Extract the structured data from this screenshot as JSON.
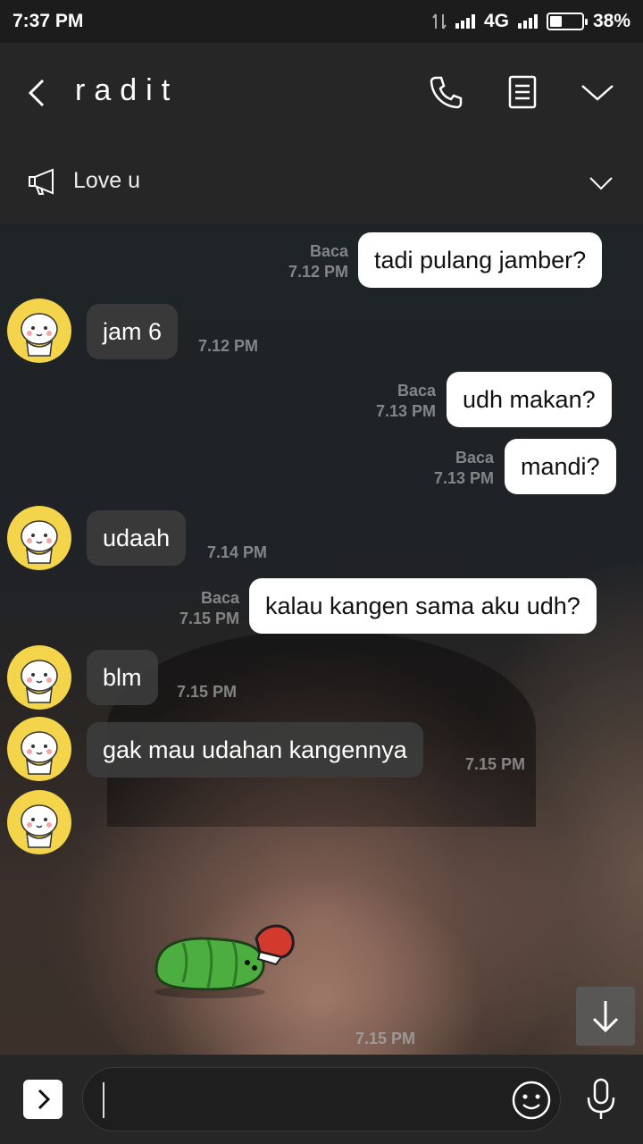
{
  "status_bar": {
    "time": "7:37 PM",
    "network": "4G",
    "battery": "38%",
    "battery_level": 0.38
  },
  "header": {
    "title": "radit",
    "back_icon": "chevron-left-icon",
    "call_icon": "phone-icon",
    "notes_icon": "notes-icon",
    "menu_icon": "chevron-down-icon"
  },
  "announcement": {
    "text": "Love u",
    "icon": "megaphone-icon"
  },
  "messages": [
    {
      "dir": "out",
      "text": "tadi pulang jamber?",
      "read": "Baca",
      "time": "7.12 PM"
    },
    {
      "dir": "in",
      "text": "jam 6",
      "time": "7.12 PM"
    },
    {
      "dir": "out",
      "text": "udh makan?",
      "read": "Baca",
      "time": "7.13 PM"
    },
    {
      "dir": "out",
      "text": "mandi?",
      "read": "Baca",
      "time": "7.13 PM"
    },
    {
      "dir": "in",
      "text": "udaah",
      "time": "7.14 PM"
    },
    {
      "dir": "out",
      "text": "kalau kangen sama aku udh?",
      "read": "Baca",
      "time": "7.15 PM"
    },
    {
      "dir": "in",
      "text": "blm",
      "time": "7.15 PM"
    },
    {
      "dir": "in",
      "text": "gak mau udahan kangennya",
      "time": "7.15 PM"
    },
    {
      "dir": "in",
      "type": "sticker",
      "sticker": "green-caterpillar-sticker",
      "time": "7.15 PM"
    }
  ],
  "input": {
    "placeholder": "",
    "emoji_icon": "emoji-icon",
    "mic_icon": "microphone-icon",
    "expand_icon": "chevron-right-icon"
  },
  "scroll_down_icon": "arrow-down-icon"
}
